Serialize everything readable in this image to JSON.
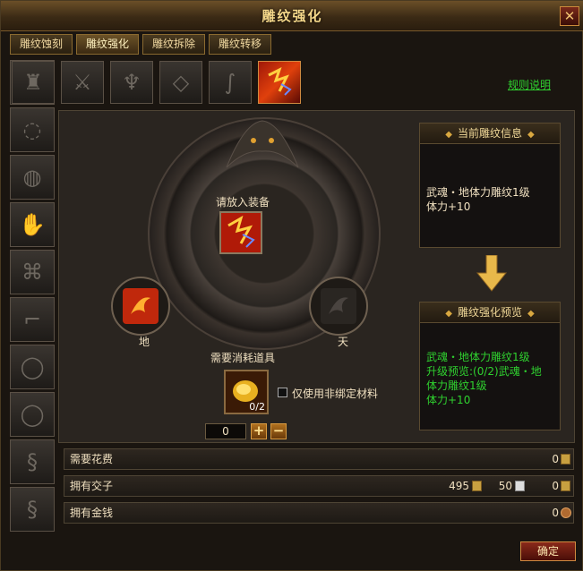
{
  "window": {
    "title": "雕纹强化",
    "close_label": "✕"
  },
  "tabs": [
    {
      "label": "雕纹蚀刻",
      "active": false
    },
    {
      "label": "雕纹强化",
      "active": true
    },
    {
      "label": "雕纹拆除",
      "active": false
    },
    {
      "label": "雕纹转移",
      "active": false
    }
  ],
  "equipment_slots": {
    "left_column": [
      "helmet-icon",
      "bracelet-icon",
      "bracer-icon",
      "glove-icon",
      "belt-icon",
      "boot-icon",
      "ring-icon",
      "ring-icon",
      "scroll-icon",
      "scroll-icon"
    ],
    "top_row": [
      "helmet-icon",
      "sword-icon",
      "armor-icon",
      "necklace-icon",
      "claw-icon",
      "carving-icon"
    ],
    "selected": "carving-icon"
  },
  "rules_link": "规则说明",
  "current_info": {
    "header": "当前雕纹信息",
    "lines": [
      "武魂・地体力雕纹1级",
      "体力+10"
    ]
  },
  "preview": {
    "header": "雕纹强化预览",
    "lines": [
      "武魂・地体力雕纹1级",
      "升级预览:(0/2)武魂・地",
      "体力雕纹1级",
      "体力+10"
    ]
  },
  "center": {
    "place_label": "请放入装备",
    "earth_label": "地",
    "sky_label": "天",
    "consume_label": "需要消耗道具",
    "consume_count": "0/2",
    "bind_checkbox_label": "仅使用非绑定材料",
    "bind_checked": false,
    "quantity": "0",
    "plus_label": "+",
    "minus_label": "−"
  },
  "costs": {
    "need_label": "需要花费",
    "need_value": "0",
    "jiaozi_label": "拥有交子",
    "jiaozi_gold": "495",
    "jiaozi_silver": "50",
    "jiaozi_other": "0",
    "money_label": "拥有金钱",
    "money_value": "0"
  },
  "confirm_label": "确定",
  "colors": {
    "green_text": "#2fd12f",
    "gold_text": "#f5d88a"
  }
}
